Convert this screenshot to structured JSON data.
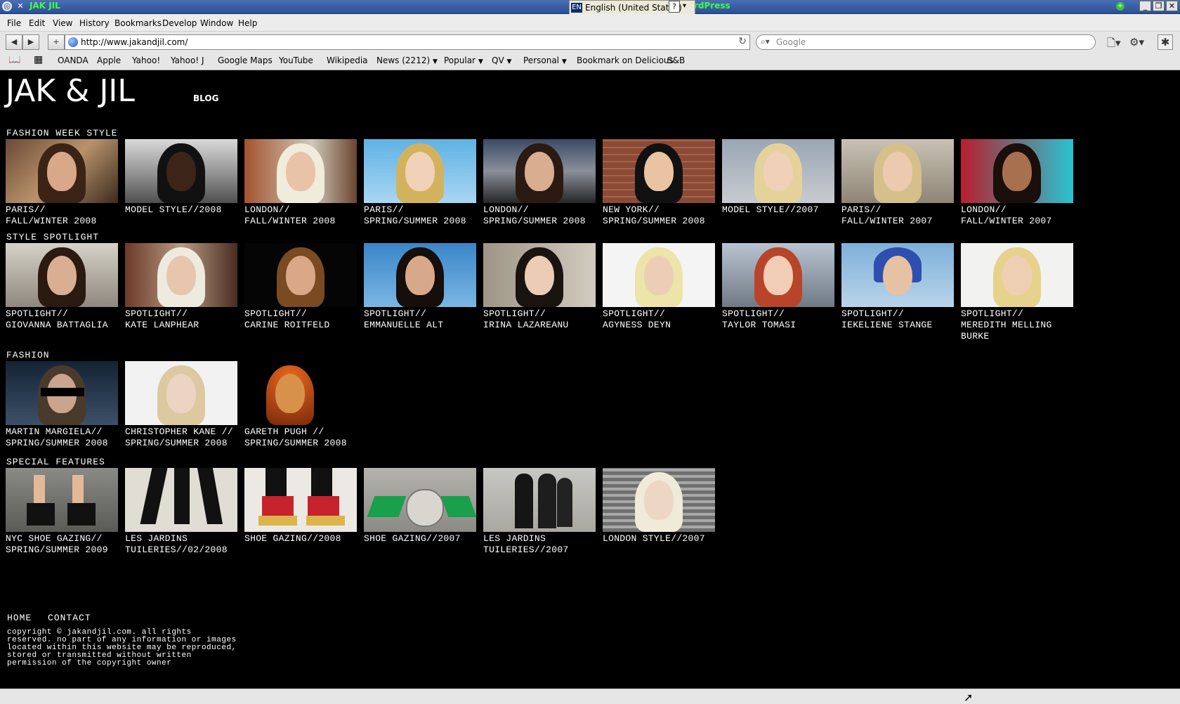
{
  "window": {
    "title": "JAK JIL",
    "partial_title": "rdPress",
    "language": {
      "code": "EN",
      "label": "English (United States)",
      "help": "?"
    }
  },
  "menu": [
    "File",
    "Edit",
    "View",
    "History",
    "Bookmarks",
    "Develop",
    "Window",
    "Help"
  ],
  "toolbar": {
    "url": "http://www.jakandjil.com/",
    "search_placeholder": "Google"
  },
  "bookmarks": [
    "OANDA",
    "Apple",
    "Yahoo!",
    "Yahoo! J",
    "Google Maps",
    "YouTube",
    "Wikipedia",
    "News (2212)",
    "Popular",
    "QV",
    "Personal",
    "Bookmark on Delicious",
    "S&B"
  ],
  "site": {
    "logo": "JAK & JIL",
    "blog_link": "BLOG",
    "sections": [
      {
        "title": "FASHION WEEK STYLE",
        "items": [
          {
            "caption": "PARIS//\nFALL/WINTER 2008"
          },
          {
            "caption": "MODEL STYLE//2008"
          },
          {
            "caption": "LONDON//\nFALL/WINTER 2008"
          },
          {
            "caption": "PARIS//\nSPRING/SUMMER 2008"
          },
          {
            "caption": "LONDON//\nSPRING/SUMMER 2008"
          },
          {
            "caption": "NEW YORK//\nSPRING/SUMMER 2008"
          },
          {
            "caption": "MODEL STYLE//2007"
          },
          {
            "caption": "PARIS//\nFALL/WINTER 2007"
          },
          {
            "caption": "LONDON//\nFALL/WINTER 2007"
          }
        ]
      },
      {
        "title": "STYLE SPOTLIGHT",
        "items": [
          {
            "caption": "SPOTLIGHT//\nGIOVANNA BATTAGLIA"
          },
          {
            "caption": "SPOTLIGHT//\nKATE LANPHEAR"
          },
          {
            "caption": "SPOTLIGHT//\nCARINE ROITFELD"
          },
          {
            "caption": "SPOTLIGHT//\nEMMANUELLE ALT"
          },
          {
            "caption": "SPOTLIGHT//\nIRINA LAZAREANU"
          },
          {
            "caption": "SPOTLIGHT//\nAGYNESS DEYN"
          },
          {
            "caption": "SPOTLIGHT//\nTAYLOR TOMASI"
          },
          {
            "caption": "SPOTLIGHT//\nIEKELIENE STANGE"
          },
          {
            "caption": "SPOTLIGHT//\nMEREDITH MELLING\nBURKE"
          }
        ]
      },
      {
        "title": "FASHION",
        "items": [
          {
            "caption": "MARTIN MARGIELA//\nSPRING/SUMMER 2008"
          },
          {
            "caption": "CHRISTOPHER KANE //\nSPRING/SUMMER 2008"
          },
          {
            "caption": "GARETH PUGH //\nSPRING/SUMMER 2008"
          }
        ]
      },
      {
        "title": "SPECIAL FEATURES",
        "items": [
          {
            "caption": "NYC SHOE GAZING//\nSPRING/SUMMER 2009"
          },
          {
            "caption": "LES JARDINS\nTUILERIES//02/2008"
          },
          {
            "caption": "SHOE GAZING//2008"
          },
          {
            "caption": "SHOE GAZING//2007"
          },
          {
            "caption": "LES JARDINS\nTUILERIES//2007"
          },
          {
            "caption": "LONDON STYLE//2007"
          }
        ]
      }
    ],
    "footer": {
      "links": [
        "HOME",
        "CONTACT"
      ],
      "copyright": "copyright © jakandjil.com. all rights reserved. no part of any information or images located within this website may be reproduced, stored or transmitted without written permission of the copyright owner"
    }
  }
}
